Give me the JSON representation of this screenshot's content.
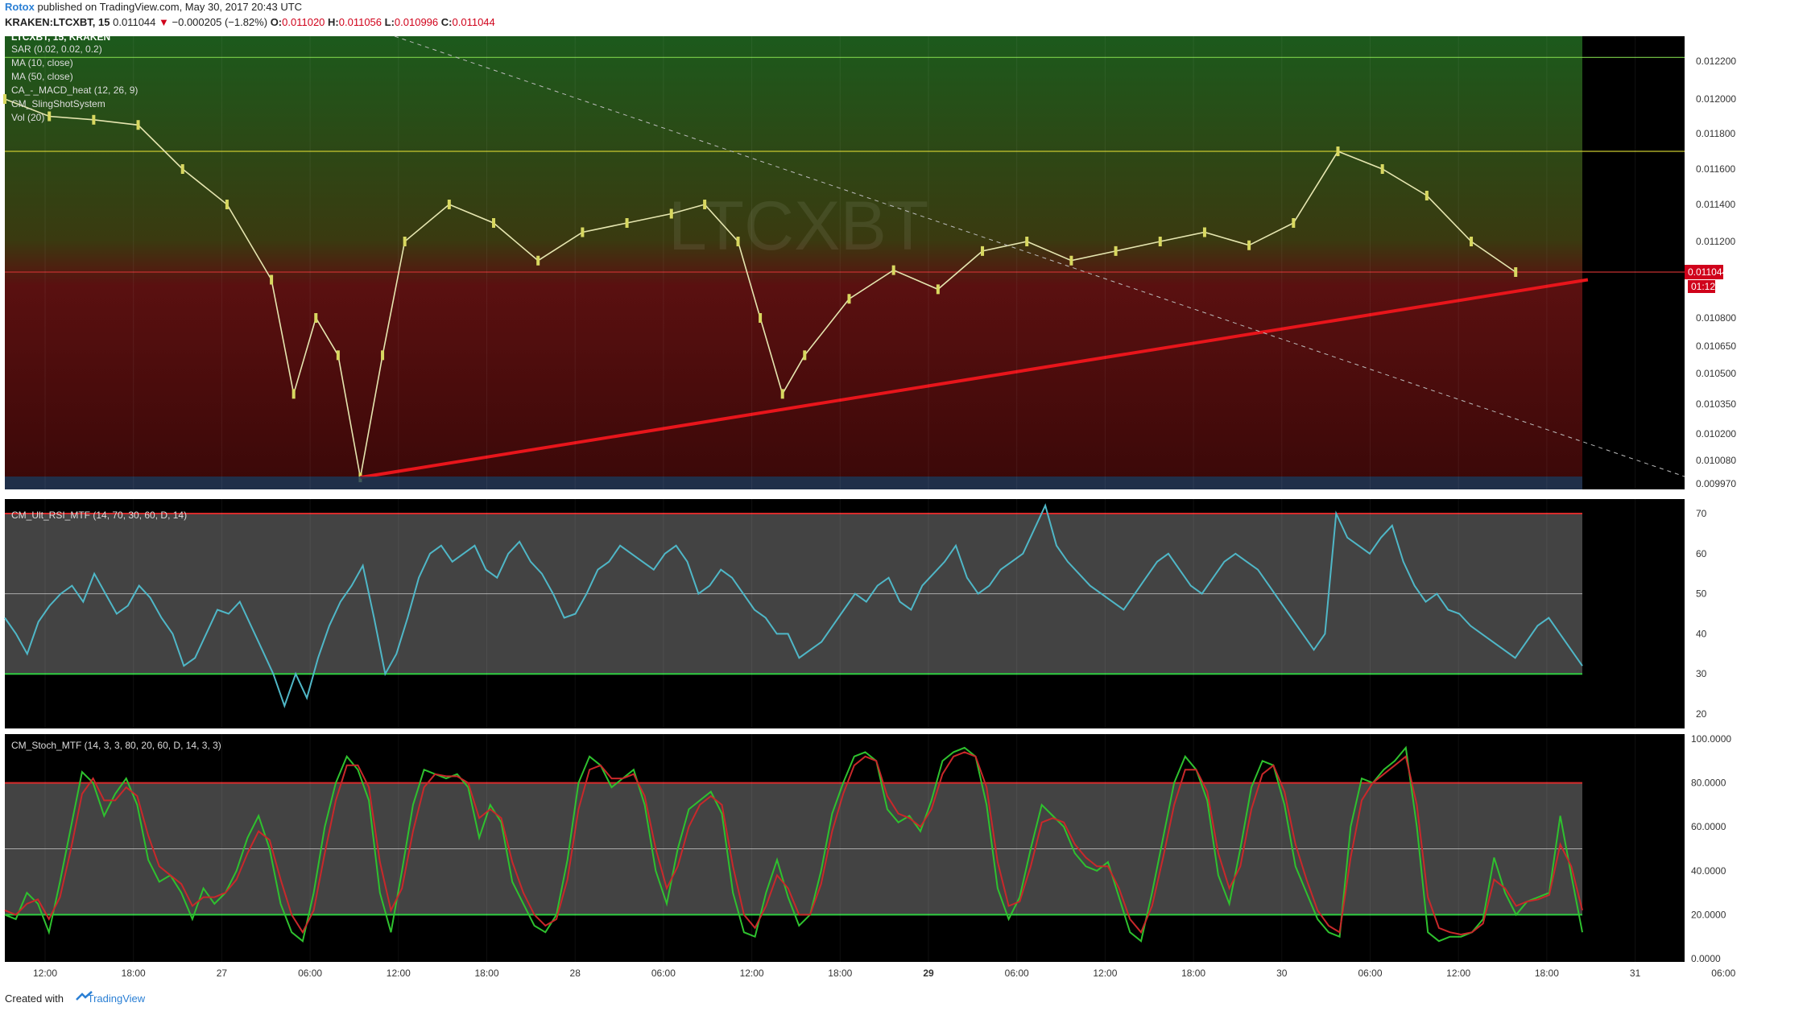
{
  "header": {
    "publisher": "Rotox",
    "published_text": "published on TradingView.com, May 30, 2017 20:43 UTC",
    "symbol": "KRAKEN:LTCXBT, 15",
    "price": "0.011044",
    "change": "−0.000205 (−1.82%)",
    "o_label": "O:",
    "o": "0.011020",
    "h_label": "H:",
    "h": "0.011056",
    "l_label": "L:",
    "l": "0.010996",
    "c_label": "C:",
    "c": "0.011044"
  },
  "footer": {
    "created_with": "Created with",
    "brand": "TradingView"
  },
  "colors": {
    "price_line": "#e8151b",
    "rsi": "#4fb7c7",
    "stoch_k": "#2ec12e",
    "stoch_d": "#c9282a",
    "band_fill": "#5a5a5a",
    "upper_line": "#d92b2b",
    "lower_line": "#2ecc40",
    "ma10": "#e0e040",
    "ma50": "#ffd21f",
    "sar": "#b8e0ff"
  },
  "chart_data": [
    {
      "type": "candlestick",
      "title": "LTCXBT, 15, KRAKEN",
      "watermark": "LTCXBT",
      "indicators": [
        "SAR (0.02, 0.02, 0.2)",
        "MA (10, close)",
        "MA (50, close)",
        "CA_-_MACD_heat (12, 26, 9)",
        "CM_SlingShotSystem",
        "Vol (20)"
      ],
      "y_ticks": [
        "0.012200",
        "0.012000",
        "0.011800",
        "0.011600",
        "0.011400",
        "0.011200",
        "0.010800",
        "0.010650",
        "0.010500",
        "0.010350",
        "0.010200",
        "0.010080",
        "0.009970"
      ],
      "y_tick_values": [
        0.0122,
        0.012,
        0.0118,
        0.0116,
        0.0114,
        0.0112,
        0.0108,
        0.01065,
        0.0105,
        0.01035,
        0.0102,
        0.01008,
        0.00997
      ],
      "last_price_label": "0.011044",
      "countdown_label": "01:12",
      "price_points": [
        {
          "t": 0,
          "v": 0.012
        },
        {
          "t": 4,
          "v": 0.0119
        },
        {
          "t": 8,
          "v": 0.01188
        },
        {
          "t": 12,
          "v": 0.01185
        },
        {
          "t": 16,
          "v": 0.0116
        },
        {
          "t": 20,
          "v": 0.0114
        },
        {
          "t": 24,
          "v": 0.011
        },
        {
          "t": 26,
          "v": 0.0104
        },
        {
          "t": 28,
          "v": 0.0108
        },
        {
          "t": 30,
          "v": 0.0106
        },
        {
          "t": 32,
          "v": 0.01
        },
        {
          "t": 34,
          "v": 0.0106
        },
        {
          "t": 36,
          "v": 0.0112
        },
        {
          "t": 40,
          "v": 0.0114
        },
        {
          "t": 44,
          "v": 0.0113
        },
        {
          "t": 48,
          "v": 0.0111
        },
        {
          "t": 52,
          "v": 0.01125
        },
        {
          "t": 56,
          "v": 0.0113
        },
        {
          "t": 60,
          "v": 0.01135
        },
        {
          "t": 63,
          "v": 0.0114
        },
        {
          "t": 66,
          "v": 0.0112
        },
        {
          "t": 68,
          "v": 0.0108
        },
        {
          "t": 70,
          "v": 0.0104
        },
        {
          "t": 72,
          "v": 0.0106
        },
        {
          "t": 76,
          "v": 0.0109
        },
        {
          "t": 80,
          "v": 0.01105
        },
        {
          "t": 84,
          "v": 0.01095
        },
        {
          "t": 88,
          "v": 0.01115
        },
        {
          "t": 92,
          "v": 0.0112
        },
        {
          "t": 96,
          "v": 0.0111
        },
        {
          "t": 100,
          "v": 0.01115
        },
        {
          "t": 104,
          "v": 0.0112
        },
        {
          "t": 108,
          "v": 0.01125
        },
        {
          "t": 112,
          "v": 0.01118
        },
        {
          "t": 116,
          "v": 0.0113
        },
        {
          "t": 120,
          "v": 0.0117
        },
        {
          "t": 124,
          "v": 0.0116
        },
        {
          "t": 128,
          "v": 0.01145
        },
        {
          "t": 132,
          "v": 0.0112
        },
        {
          "t": 136,
          "v": 0.01104
        }
      ],
      "trendline": {
        "from": {
          "t": 32,
          "v": 0.01
        },
        "to": {
          "t": 142.5,
          "v": 0.011
        }
      },
      "resistance_lines": [
        0.01222,
        0.0117,
        0.01104
      ]
    },
    {
      "type": "line",
      "title": "CM_Ult_RSI_MTF (14, 70, 30, 60, D, 14)",
      "y_ticks": [
        "70",
        "60",
        "50",
        "40",
        "30",
        "20"
      ],
      "y_tick_values": [
        70,
        60,
        50,
        40,
        30,
        20
      ],
      "upper": 70,
      "mid": 50,
      "lower": 30,
      "values": [
        44,
        40,
        35,
        43,
        47,
        50,
        52,
        48,
        55,
        50,
        45,
        47,
        52,
        49,
        44,
        40,
        32,
        34,
        40,
        46,
        45,
        48,
        42,
        36,
        30,
        22,
        30,
        24,
        34,
        42,
        48,
        52,
        57,
        44,
        30,
        35,
        44,
        54,
        60,
        62,
        58,
        60,
        62,
        56,
        54,
        60,
        63,
        58,
        55,
        50,
        44,
        45,
        50,
        56,
        58,
        62,
        60,
        58,
        56,
        60,
        62,
        58,
        50,
        52,
        56,
        54,
        50,
        46,
        44,
        40,
        40,
        34,
        36,
        38,
        42,
        46,
        50,
        48,
        52,
        54,
        48,
        46,
        52,
        55,
        58,
        62,
        54,
        50,
        52,
        56,
        58,
        60,
        66,
        72,
        62,
        58,
        55,
        52,
        50,
        48,
        46,
        50,
        54,
        58,
        60,
        56,
        52,
        50,
        54,
        58,
        60,
        58,
        56,
        52,
        48,
        44,
        40,
        36,
        40,
        70,
        64,
        62,
        60,
        64,
        67,
        58,
        52,
        48,
        50,
        46,
        45,
        42,
        40,
        38,
        36,
        34,
        38,
        42,
        44,
        40,
        36,
        32
      ]
    },
    {
      "type": "line",
      "title": "CM_Stoch_MTF (14, 3, 3, 80, 20, 60, D, 14, 3, 3)",
      "y_ticks": [
        "100.0000",
        "80.0000",
        "60.0000",
        "40.0000",
        "20.0000",
        "0.0000"
      ],
      "y_tick_values": [
        100,
        80,
        60,
        40,
        20,
        0
      ],
      "upper": 80,
      "mid": 50,
      "lower": 20,
      "series": [
        {
          "name": "",
          "values": [
            20,
            18,
            30,
            25,
            12,
            35,
            60,
            85,
            80,
            65,
            75,
            82,
            70,
            45,
            35,
            38,
            30,
            18,
            32,
            25,
            30,
            40,
            55,
            65,
            50,
            25,
            12,
            8,
            30,
            60,
            80,
            92,
            86,
            72,
            30,
            12,
            40,
            70,
            86,
            84,
            82,
            84,
            78,
            55,
            70,
            62,
            35,
            25,
            15,
            12,
            20,
            45,
            80,
            92,
            88,
            78,
            82,
            86,
            70,
            40,
            25,
            50,
            68,
            72,
            76,
            66,
            30,
            12,
            10,
            30,
            45,
            28,
            15,
            20,
            40,
            66,
            80,
            92,
            94,
            90,
            68,
            62,
            65,
            58,
            72,
            90,
            94,
            96,
            92,
            70,
            32,
            18,
            28,
            50,
            70,
            65,
            60,
            48,
            42,
            40,
            44,
            28,
            12,
            8,
            30,
            55,
            80,
            92,
            86,
            72,
            38,
            25,
            50,
            78,
            90,
            88,
            70,
            42,
            30,
            18,
            12,
            10,
            60,
            82,
            80,
            86,
            90,
            96,
            60,
            12,
            8,
            10,
            10,
            12,
            18,
            46,
            30,
            20,
            26,
            28,
            30,
            65,
            38,
            12
          ]
        },
        {
          "name": "",
          "values": [
            22,
            20,
            25,
            27,
            18,
            28,
            50,
            75,
            82,
            72,
            72,
            78,
            74,
            56,
            42,
            38,
            34,
            24,
            28,
            28,
            30,
            36,
            48,
            58,
            54,
            36,
            20,
            12,
            22,
            48,
            72,
            88,
            88,
            78,
            44,
            22,
            32,
            58,
            78,
            84,
            83,
            83,
            80,
            64,
            68,
            64,
            44,
            30,
            20,
            15,
            18,
            36,
            68,
            86,
            88,
            82,
            82,
            84,
            74,
            50,
            32,
            42,
            60,
            70,
            74,
            70,
            42,
            20,
            14,
            24,
            38,
            32,
            20,
            20,
            34,
            58,
            75,
            88,
            92,
            90,
            74,
            66,
            64,
            60,
            68,
            84,
            92,
            94,
            92,
            78,
            44,
            24,
            26,
            42,
            62,
            64,
            62,
            52,
            46,
            42,
            42,
            32,
            18,
            12,
            24,
            46,
            70,
            86,
            86,
            76,
            48,
            32,
            42,
            68,
            84,
            88,
            76,
            52,
            36,
            22,
            15,
            12,
            46,
            72,
            80,
            84,
            88,
            92,
            70,
            28,
            14,
            12,
            11,
            12,
            16,
            36,
            32,
            24,
            26,
            27,
            29,
            52,
            42,
            22
          ]
        }
      ]
    }
  ],
  "x_ticks": [
    "12:00",
    "18:00",
    "27",
    "06:00",
    "12:00",
    "18:00",
    "28",
    "06:00",
    "12:00",
    "18:00",
    "29",
    "06:00",
    "12:00",
    "18:00",
    "30",
    "06:00",
    "12:00",
    "18:00",
    "31",
    "06:00"
  ]
}
